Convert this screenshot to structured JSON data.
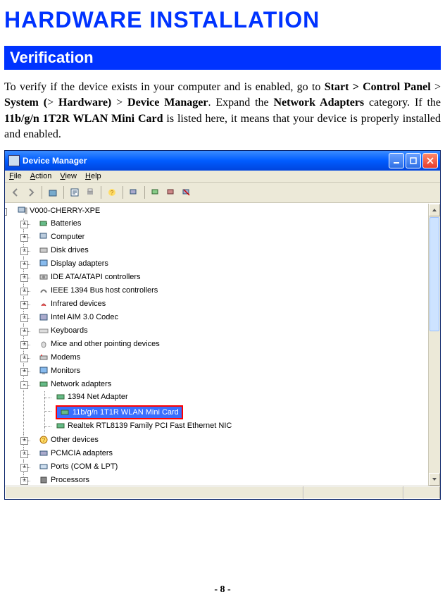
{
  "page": {
    "title": "HARDWARE INSTALLATION",
    "section": "Verification",
    "body_prefix": "To verify if the device exists in your computer and is enabled, go to ",
    "body_mid1": " > ",
    "body_mid2": " > ",
    "body_mid3": " > ",
    "body_after_dm": ". Expand the ",
    "body_after_na": " category. If the ",
    "body_tail": "  is listed here, it means that your device is properly installed and enabled.",
    "start": "Start >",
    "cp": "Control Panel",
    "system": "System (",
    "hw": "Hardware)",
    "dm": "Device Manager",
    "na": "Network Adapters",
    "card": "11b/g/n 1T2R WLAN Mini Card",
    "footer": "- 8 -"
  },
  "dm": {
    "title": "Device Manager",
    "menu": {
      "file": "File",
      "action": "Action",
      "view": "View",
      "help": "Help"
    },
    "root": "V000-CHERRY-XPE",
    "nodes": [
      "Batteries",
      "Computer",
      "Disk drives",
      "Display adapters",
      "IDE ATA/ATAPI controllers",
      "IEEE 1394 Bus host controllers",
      "Infrared devices",
      "Intel AIM 3.0 Codec",
      "Keyboards",
      "Mice and other pointing devices",
      "Modems",
      "Monitors"
    ],
    "net": "Network adapters",
    "net_children": {
      "top": "1394 Net Adapter",
      "highlight": "11b/g/n 1T1R WLAN Mini Card",
      "bottom": "Realtek RTL8139 Family PCI Fast Ethernet NIC"
    },
    "after": [
      "Other devices",
      "PCMCIA adapters",
      "Ports (COM & LPT)",
      "Processors"
    ]
  }
}
